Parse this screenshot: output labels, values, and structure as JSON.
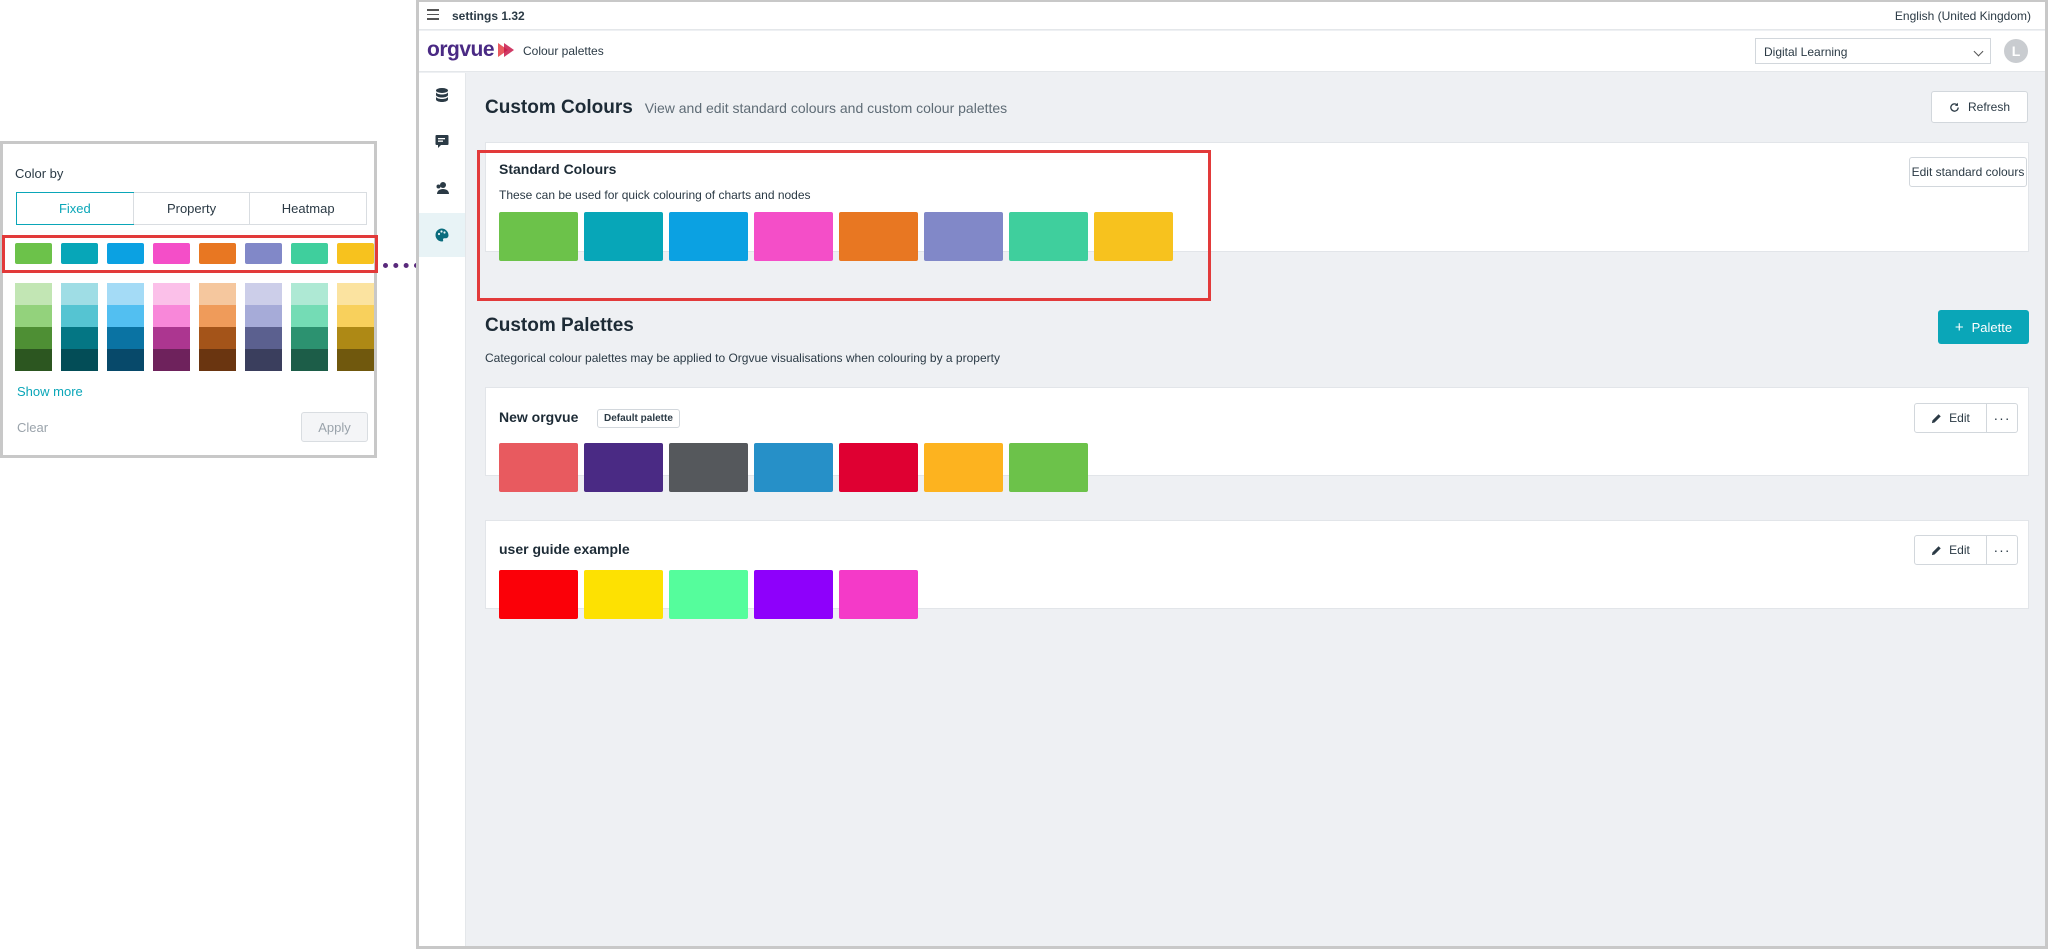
{
  "colorby": {
    "title": "Color by",
    "tabs": [
      "Fixed",
      "Property",
      "Heatmap"
    ],
    "active_tab": "Fixed",
    "fixed_colors": [
      "#6cc24a",
      "#07a6b8",
      "#0ba1e2",
      "#f44ec8",
      "#e87722",
      "#8188c8",
      "#3fcf9d",
      "#f7c21e"
    ],
    "shade_columns": [
      [
        "#c2e6b4",
        "#93d27c",
        "#4e8f34",
        "#2c5620"
      ],
      [
        "#9fdde5",
        "#55c4d2",
        "#047684",
        "#034d57"
      ],
      [
        "#a4dbf6",
        "#52bff1",
        "#0a73a3",
        "#07496a"
      ],
      [
        "#fbc0e9",
        "#f887d9",
        "#ac3690",
        "#6e225c"
      ],
      [
        "#f5c79e",
        "#ef9b5a",
        "#a45419",
        "#6a3510"
      ],
      [
        "#cccee9",
        "#a6abd8",
        "#5b608f",
        "#3a3e5d"
      ],
      [
        "#aee9d4",
        "#74dcb5",
        "#2c9270",
        "#1c5d48"
      ],
      [
        "#fbe3a0",
        "#f8d05c",
        "#ae8915",
        "#70580d"
      ]
    ],
    "show_more": "Show more",
    "clear": "Clear",
    "apply": "Apply"
  },
  "app": {
    "title": "settings 1.32",
    "language": "English (United Kingdom)",
    "logo": "orgvue",
    "section": "Colour palettes",
    "workspace": "Digital Learning",
    "avatar_initial": "L",
    "sidebar_icons": [
      "database-icon",
      "chart-icon",
      "people-icon",
      "palette-icon"
    ]
  },
  "page": {
    "title": "Custom Colours",
    "subtitle": "View and edit standard colours and custom colour palettes",
    "refresh": "Refresh"
  },
  "standard": {
    "title": "Standard Colours",
    "description": "These can be used for quick colouring of charts and nodes",
    "edit_button": "Edit standard colours",
    "colors": [
      "#6cc24a",
      "#07a6b8",
      "#0ba1e2",
      "#f44ec8",
      "#e87722",
      "#8188c8",
      "#3fcf9d",
      "#f7c21e"
    ]
  },
  "custom": {
    "title": "Custom Palettes",
    "description": "Categorical colour palettes may be applied to Orgvue visualisations when colouring by a property",
    "add_button": "Palette",
    "palettes": [
      {
        "name": "New orgvue",
        "badge": "Default palette",
        "edit": "Edit",
        "more": "···",
        "colors": [
          "#e85a5f",
          "#4a2a84",
          "#55585c",
          "#2690c8",
          "#df0032",
          "#fdb31f",
          "#6cc24a"
        ]
      },
      {
        "name": "user guide example",
        "badge": "",
        "edit": "Edit",
        "more": "···",
        "colors": [
          "#fb0008",
          "#fde102",
          "#55fd9c",
          "#8e00fb",
          "#f43ac8"
        ]
      }
    ]
  },
  "colors": {
    "accent": "#0aa6b8",
    "highlight": "#e23a3a",
    "arrow": "#5a2a7c"
  }
}
